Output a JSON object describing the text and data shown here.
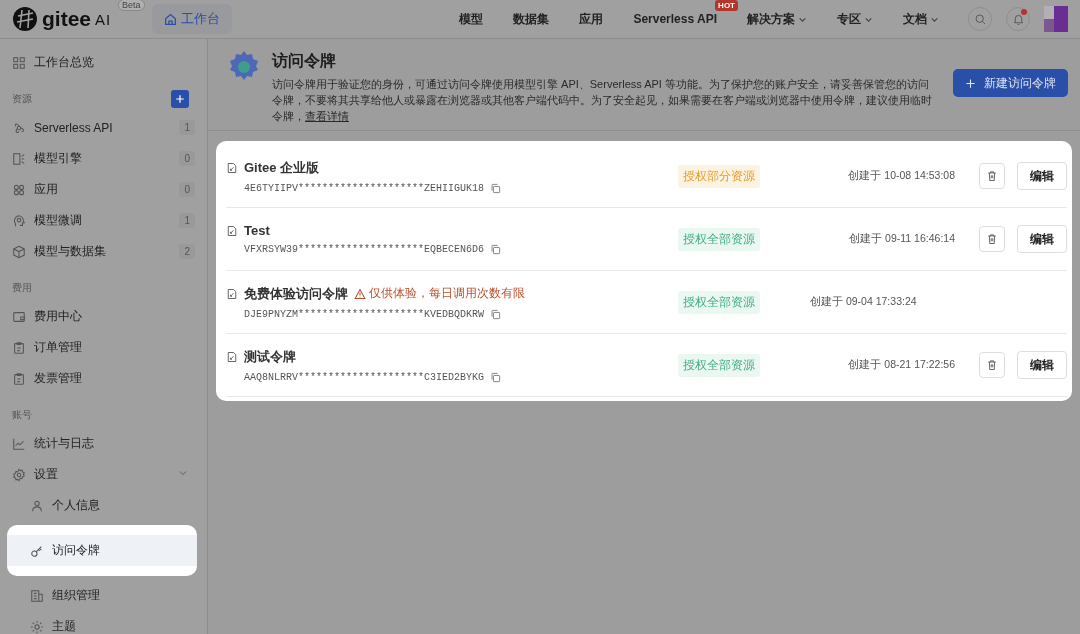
{
  "brand": {
    "name": "gitee",
    "suffix": "AI",
    "badge": "Beta"
  },
  "workbench_tab": {
    "label": "工作台",
    "selected": true
  },
  "nav": [
    {
      "label": "模型",
      "dropdown": false
    },
    {
      "label": "数据集",
      "dropdown": false
    },
    {
      "label": "应用",
      "dropdown": false
    },
    {
      "label": "Serverless API",
      "dropdown": false,
      "badge": "HOT"
    },
    {
      "label": "解决方案",
      "dropdown": true
    },
    {
      "label": "专区",
      "dropdown": true
    },
    {
      "label": "文档",
      "dropdown": true
    }
  ],
  "notifications": {
    "unread": true
  },
  "sidebar": {
    "overview": "工作台总览",
    "sections": [
      {
        "title": "资源",
        "add_button": true,
        "items": [
          {
            "label": "Serverless API",
            "count": "1",
            "selected": false
          },
          {
            "label": "模型引擎",
            "count": "0",
            "selected": false
          },
          {
            "label": "应用",
            "count": "0",
            "selected": false
          },
          {
            "label": "模型微调",
            "count": "1",
            "selected": false
          },
          {
            "label": "模型与数据集",
            "count": "2",
            "selected": false
          }
        ]
      },
      {
        "title": "费用",
        "add_button": false,
        "items": [
          {
            "label": "费用中心",
            "selected": false
          },
          {
            "label": "订单管理",
            "selected": false
          },
          {
            "label": "发票管理",
            "selected": false
          }
        ]
      },
      {
        "title": "账号",
        "add_button": false,
        "items": [
          {
            "label": "统计与日志",
            "selected": false
          },
          {
            "label": "设置",
            "selected": false,
            "expanded": true,
            "children": [
              {
                "label": "个人信息",
                "selected": false
              },
              {
                "label": "访问令牌",
                "selected": true
              },
              {
                "label": "组织管理",
                "selected": false
              },
              {
                "label": "主题",
                "selected": false
              }
            ]
          }
        ]
      }
    ]
  },
  "page": {
    "title": "访问令牌",
    "description": "访问令牌用于验证您的身份，可通过访问令牌使用模型引擎 API、Serverless API 等功能。为了保护您的账户安全，请妥善保管您的访问令牌，不要将其共享给他人或暴露在浏览器或其他客户端代码中。为了安全起见，如果需要在客户端或浏览器中使用令牌，建议使用临时令牌，",
    "link": "查看详情",
    "new_button": "新建访问令牌"
  },
  "tokens": [
    {
      "name": "Gitee 企业版",
      "token": "4E6TYIIPV*********************ZEHIIGUK18",
      "scope": "授权部分资源",
      "kind": "partial",
      "created": "创建于 10-08 14:53:08",
      "editable": true,
      "edit": "编辑"
    },
    {
      "name": "Test",
      "token": "VFXRSYW39*********************EQBECEN6D6",
      "scope": "授权全部资源",
      "kind": "full",
      "created": "创建于 09-11 16:46:14",
      "editable": true,
      "edit": "编辑"
    },
    {
      "name": "免费体验访问令牌",
      "warning": "仅供体验，每日调用次数有限",
      "token": "DJE9PNYZM*********************KVEDBQDKRW",
      "scope": "授权全部资源",
      "kind": "full",
      "created": "创建于 09-04 17:33:24",
      "editable": false
    },
    {
      "name": "测试令牌",
      "token": "AAQ8NLRRV*********************C3IED2BYKG",
      "scope": "授权全部资源",
      "kind": "full",
      "created": "创建于 08-21 17:22:56",
      "editable": true,
      "edit": "编辑"
    }
  ]
}
